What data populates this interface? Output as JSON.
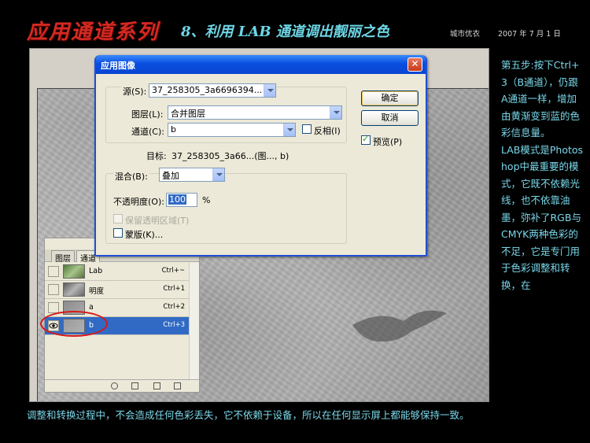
{
  "header": {
    "series_title": "应用通道系列",
    "lesson_title": "8、利用 LAB 通道调出靓丽之色",
    "author": "城市优衣",
    "date": "2007 年 7 月 1 日"
  },
  "dialog": {
    "title": "应用图像",
    "source_label": "源(S):",
    "source_value": "37_258305_3a6696394...",
    "layer_label": "图层(L):",
    "layer_value": "合并图层",
    "channel_label": "通道(C):",
    "channel_value": "b",
    "invert_label": "反相(I)",
    "target_label": "目标:",
    "target_value": "37_258305_3a66...(图..., b)",
    "blend_label": "混合(B):",
    "blend_value": "叠加",
    "opacity_label": "不透明度(O):",
    "opacity_value": "100",
    "opacity_unit": "%",
    "preserve_label": "保留透明区域(T)",
    "mask_label": "蒙版(K)...",
    "ok_label": "确定",
    "cancel_label": "取消",
    "preview_label": "预览(P)"
  },
  "channels_panel": {
    "tabs": [
      "图层",
      "通道"
    ],
    "rows": [
      {
        "name": "Lab",
        "shortcut": "Ctrl+~",
        "selected": false
      },
      {
        "name": "明度",
        "shortcut": "Ctrl+1",
        "selected": false
      },
      {
        "name": "a",
        "shortcut": "Ctrl+2",
        "selected": false
      },
      {
        "name": "b",
        "shortcut": "Ctrl+3",
        "selected": true
      }
    ]
  },
  "side_text": {
    "step": "第五步:按下Ctrl+3（B通道），仍跟A通道一样，增加由黄渐变到蓝的色彩信息量。",
    "note": "LAB模式是Photoshop中最重要的模式，它既不依赖光线，也不依靠油墨，弥补了RGB与CMYK两种色彩的不足，它是专门用于色彩调整和转换，在"
  },
  "bottom_text": "调整和转换过程中，不会造成任何色彩丢失，它不依赖于设备，所以在任何显示屏上都能够保持一致。",
  "colors": {
    "title_red": "#d32a22",
    "accent_cyan": "#7ad8ea",
    "xp_blue": "#0a4fe0",
    "selection_blue": "#316ac5",
    "annotation_red": "#d81818"
  }
}
